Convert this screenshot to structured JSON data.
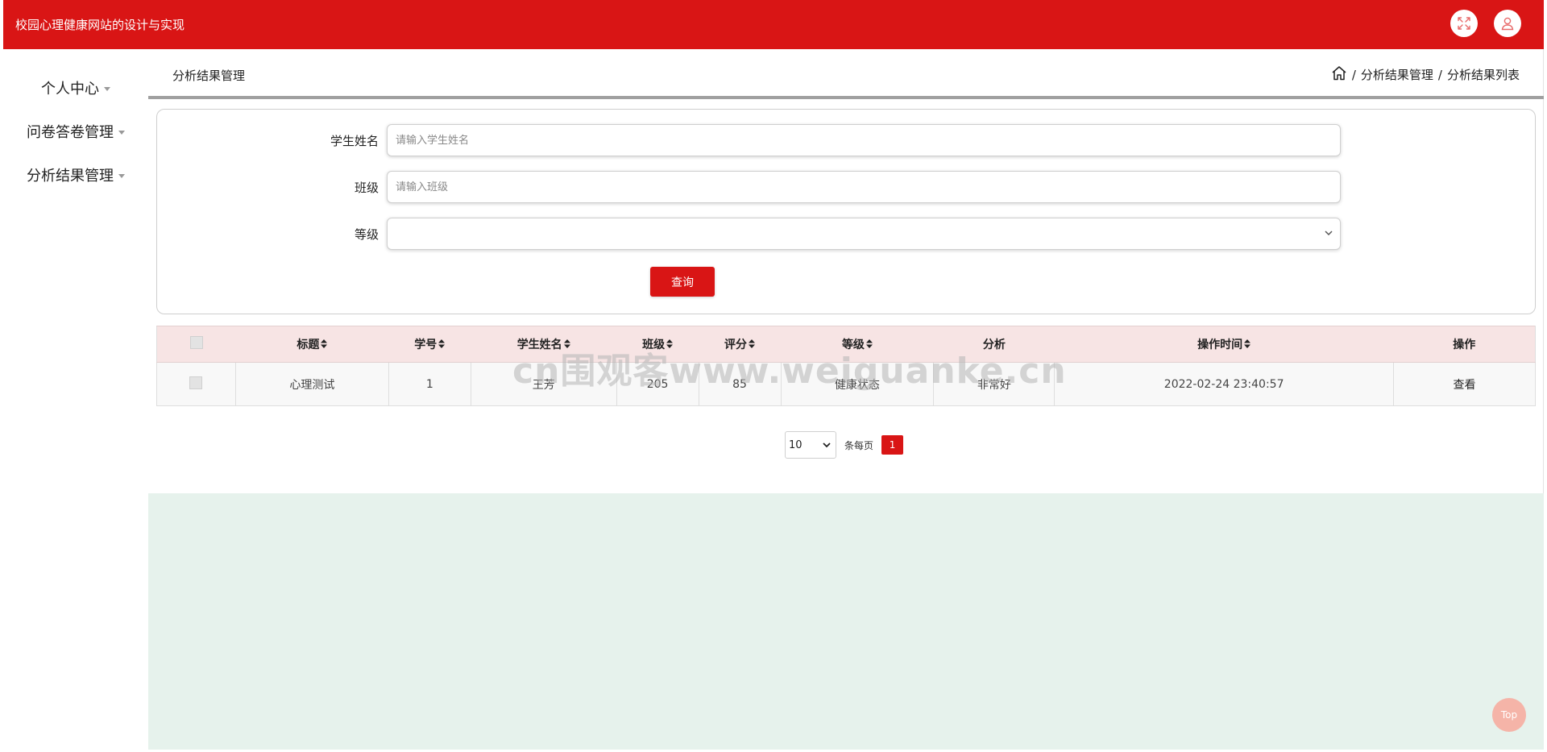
{
  "app": {
    "title": "校园心理健康网站的设计与实现"
  },
  "header_icons": [
    "fullscreen-icon",
    "user-icon"
  ],
  "sidebar": {
    "items": [
      {
        "label": "个人中心"
      },
      {
        "label": "问卷答卷管理"
      },
      {
        "label": "分析结果管理"
      }
    ]
  },
  "page": {
    "title": "分析结果管理",
    "breadcrumb": [
      "分析结果管理",
      "分析结果列表"
    ],
    "breadcrumb_sep": "/"
  },
  "search": {
    "student_name_label": "学生姓名",
    "student_name_placeholder": "请输入学生姓名",
    "class_label": "班级",
    "class_placeholder": "请输入班级",
    "level_label": "等级",
    "level_value": "",
    "query_button": "查询"
  },
  "table": {
    "columns": [
      "标题",
      "学号",
      "学生姓名",
      "班级",
      "评分",
      "等级",
      "分析",
      "操作时间",
      "操作"
    ],
    "rows": [
      {
        "title": "心理测试",
        "student_no": "1",
        "student_name": "王芳",
        "class": "205",
        "score": "85",
        "level": "健康状态",
        "analysis": "非常好",
        "time": "2022-02-24 23:40:57",
        "action": "查看"
      }
    ]
  },
  "pagination": {
    "page_size": "10",
    "per_page_label": "条每页",
    "current_page": "1"
  },
  "watermark": "cn围观客www.weiguanke.cn",
  "top_button": "Top",
  "colors": {
    "primary": "#d91515",
    "table_header_bg": "#f7e4e4",
    "footer_bg": "#e6f2ec",
    "top_button_bg": "#f5b4a8"
  }
}
